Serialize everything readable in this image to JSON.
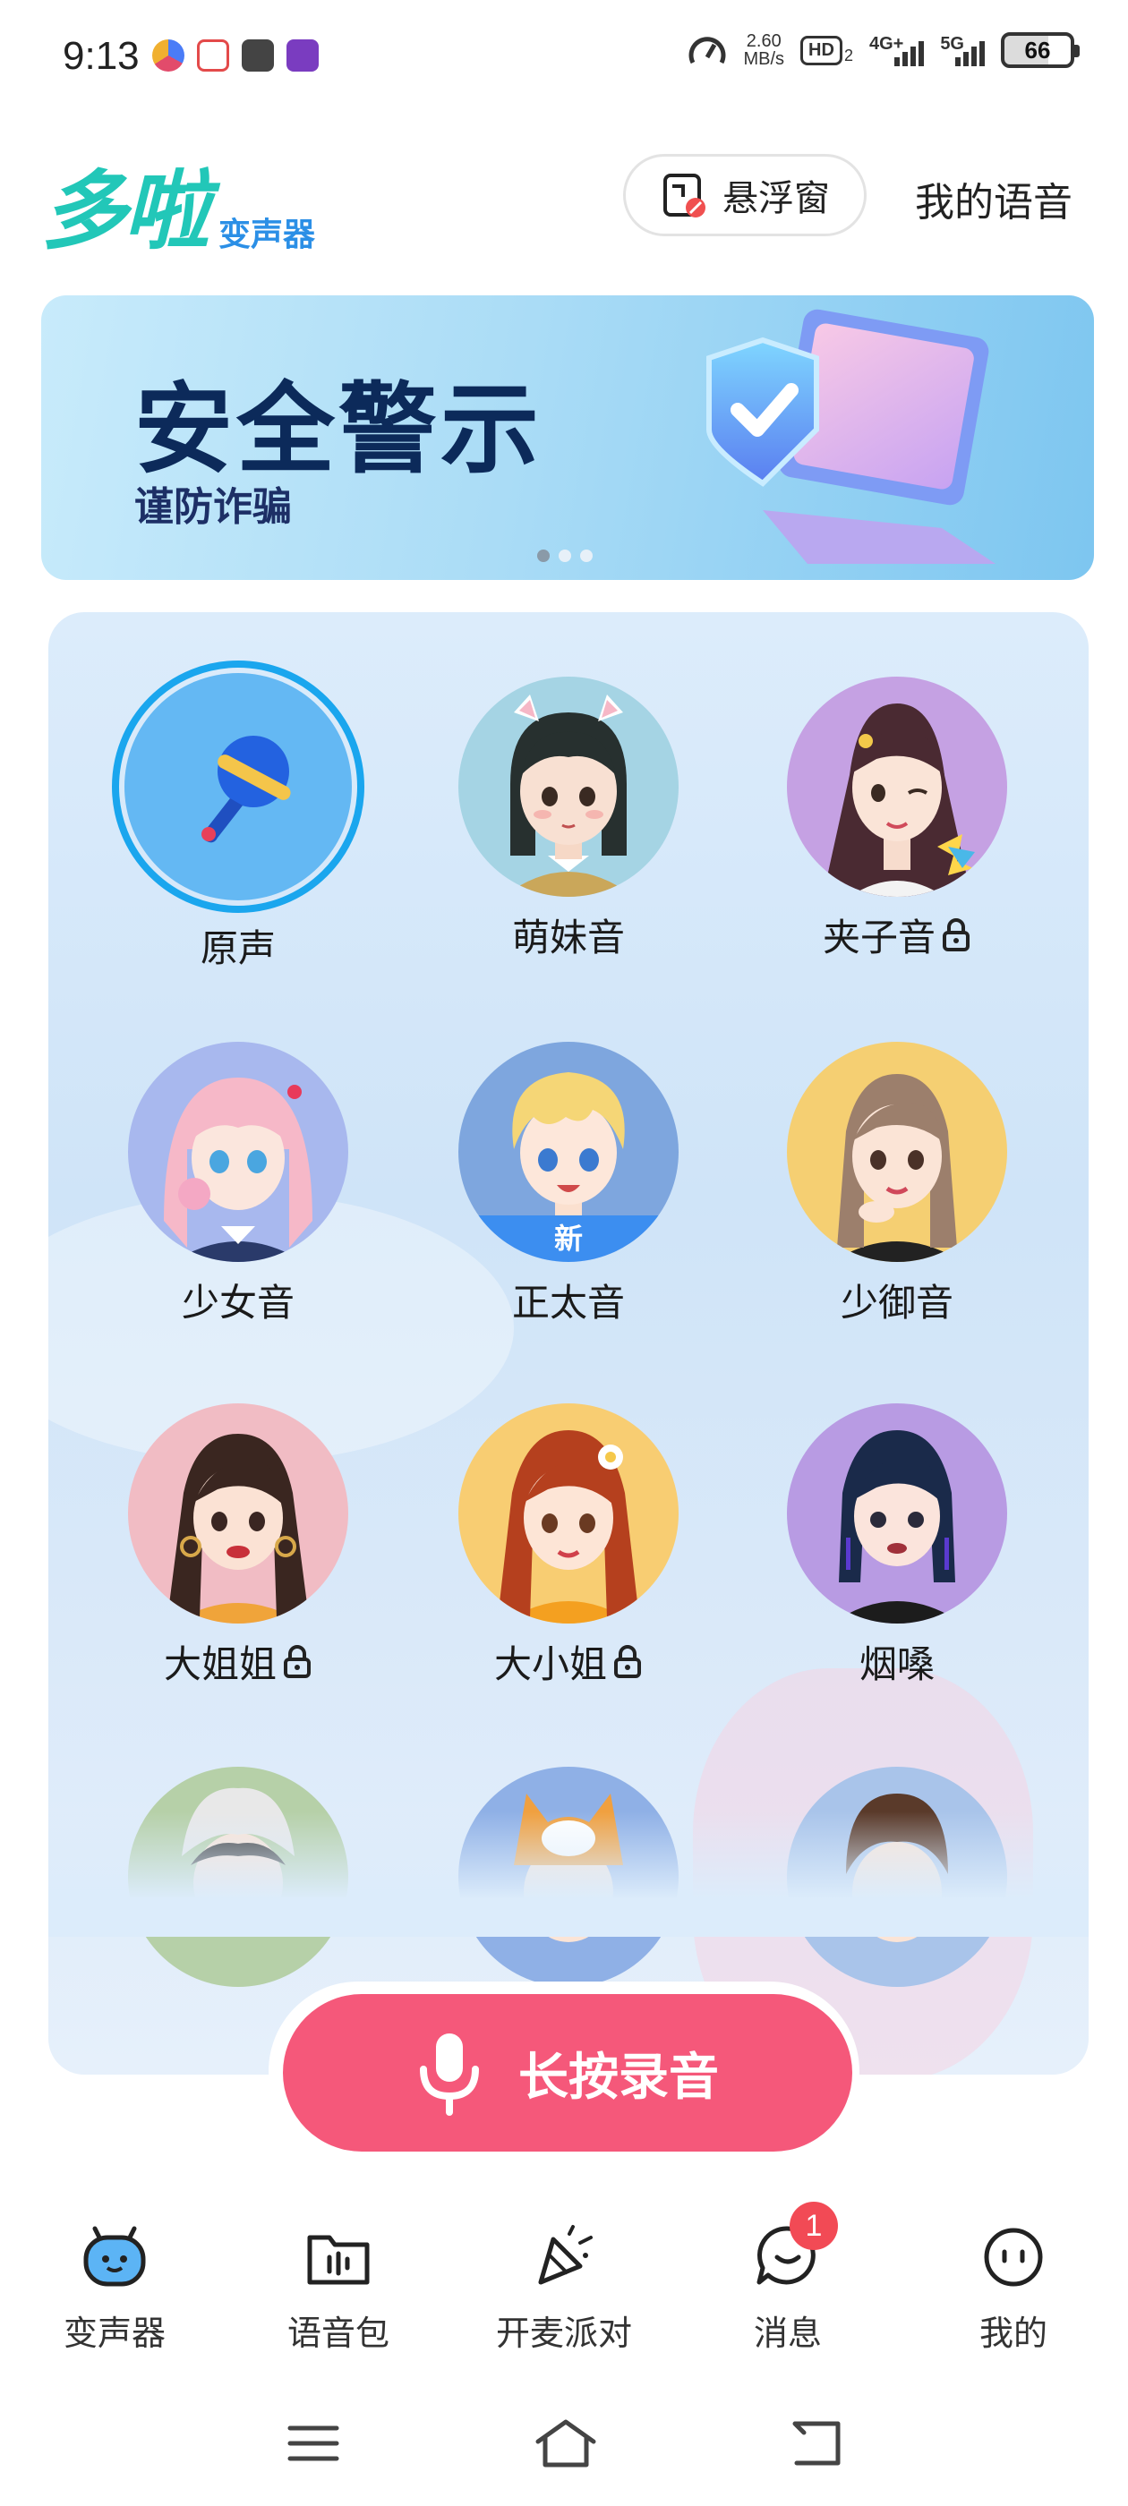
{
  "status_bar": {
    "time": "9:13",
    "network_speed_value": "2.60",
    "network_speed_unit": "MB/s",
    "hd_label": "HD",
    "hd_sub": "2",
    "signal1_label": "4G+",
    "signal2_label": "5G",
    "battery": "66"
  },
  "header": {
    "logo_main": "多啦",
    "logo_sub": "变声器",
    "float_window_label": "悬浮窗",
    "my_voice_label": "我的语音"
  },
  "banner": {
    "title": "安全警示",
    "subtitle": "谨防诈骗",
    "slides": 3,
    "active_slide": 1
  },
  "voices": [
    {
      "label": "原声",
      "locked": false,
      "selected": true
    },
    {
      "label": "萌妹音",
      "locked": false
    },
    {
      "label": "夹子音",
      "locked": true
    },
    {
      "label": "少女音",
      "locked": false
    },
    {
      "label": "正太音",
      "locked": false,
      "badge": "新"
    },
    {
      "label": "少御音",
      "locked": false
    },
    {
      "label": "大姐姐",
      "locked": true
    },
    {
      "label": "大小姐",
      "locked": true
    },
    {
      "label": "烟嗓",
      "locked": false
    }
  ],
  "record_button": {
    "label": "长按录音"
  },
  "bottom_nav": [
    {
      "label": "变声器",
      "icon": "voice-changer-robot-icon",
      "active": true
    },
    {
      "label": "语音包",
      "icon": "voice-pack-folder-icon"
    },
    {
      "label": "开麦派对",
      "icon": "party-popper-icon"
    },
    {
      "label": "消息",
      "icon": "message-bubble-icon",
      "badge": "1"
    },
    {
      "label": "我的",
      "icon": "profile-face-icon"
    }
  ],
  "colors": {
    "accent_teal": "#22c7b8",
    "accent_blue": "#1aa6ee",
    "record_pink": "#f5587a",
    "badge_red": "#f24a55"
  }
}
